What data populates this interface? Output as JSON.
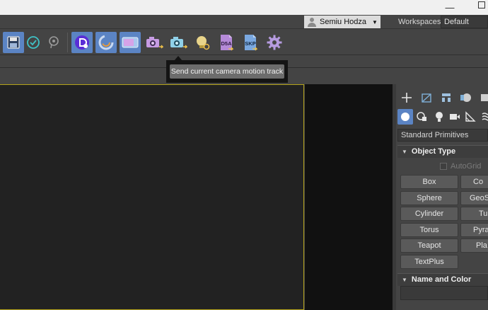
{
  "titlebar": {
    "minimize_glyph": "—"
  },
  "menubar": {
    "user_name": "Semiu Hodza",
    "user_caret": "▼",
    "workspaces_label": "Workspaces:",
    "workspace_value": "Default"
  },
  "toolbar": {
    "buttons": [
      {
        "icon": "save-file-icon",
        "active": true
      },
      {
        "icon": "checkmark-circle-icon",
        "active": false
      },
      {
        "icon": "lasso-select-icon",
        "active": false
      },
      {
        "icon": "d5-render-logo-icon",
        "active": true
      },
      {
        "icon": "sync-ring-icon",
        "active": true
      },
      {
        "icon": "video-clip-icon",
        "active": true
      },
      {
        "icon": "send-camera-icon",
        "active": false
      },
      {
        "icon": "send-camera-motion-icon",
        "active": false
      },
      {
        "icon": "light-bulb-icon",
        "active": false
      },
      {
        "icon": "d5a-file-icon",
        "active": false,
        "label": "D5A"
      },
      {
        "icon": "skp-file-icon",
        "active": false,
        "label": "SKP"
      },
      {
        "icon": "settings-gear-icon",
        "active": false
      }
    ],
    "tooltip": "Send current camera motion track"
  },
  "command_panel": {
    "tabs": [
      "create-plus-icon",
      "modify-icon",
      "hierarchy-icon",
      "motion-icon",
      "display-icon"
    ],
    "subcategories": [
      "geometry-sphere-icon",
      "shapes-icon",
      "lights-icon",
      "cameras-icon",
      "helpers-icon",
      "space-warps-icon"
    ],
    "dropdown_value": "Standard Primitives",
    "object_type_title": "Object Type",
    "autogrid_label": "AutoGrid",
    "primitives_left": [
      "Box",
      "Sphere",
      "Cylinder",
      "Torus",
      "Teapot",
      "TextPlus"
    ],
    "primitives_right": [
      "Co",
      "GeoS",
      "Tu",
      "Pyra",
      "Pla"
    ],
    "name_color_title": "Name and Color",
    "rollout_triangle": "▼"
  },
  "colors": {
    "accent": "#5b84c4",
    "viewport_border": "#b4a21a",
    "viewport_bg": "#222222"
  }
}
